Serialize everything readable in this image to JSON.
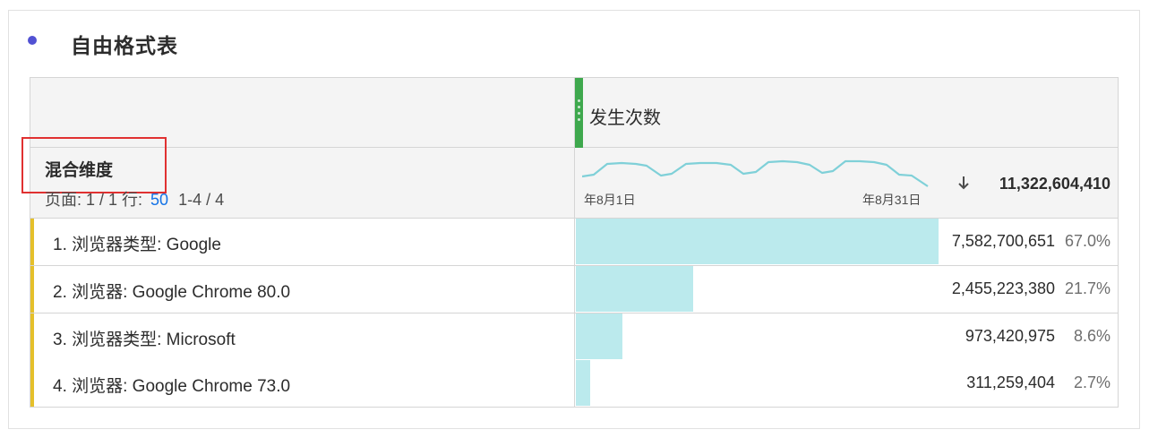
{
  "panel": {
    "title": "自由格式表",
    "dot_color": "#5151d3",
    "dot_icon": "panel-status-dot"
  },
  "table": {
    "metric": {
      "title": "发生次数",
      "handle_color": "#3ea84d",
      "handle_icon": "drag-grip-icon"
    },
    "dimension": {
      "title": "混合维度",
      "highlight_color": "#e03131"
    },
    "pager": {
      "page_label": "页面: 1 / 1 行:",
      "rows_per_page": "50",
      "range": "1-4 / 4"
    },
    "sparkline": {
      "start_label": "年8月1日",
      "end_label": "年8月31日",
      "color": "#7fd0d8"
    },
    "sort_icon": "arrow-down-icon",
    "total": "11,322,604,410",
    "bar_color": "#bbeaed",
    "accent_color": "#e5c02b",
    "rows": [
      {
        "label": "1. 浏览器类型: Google",
        "value": "7,582,700,651",
        "percent": "67.0%",
        "share": 0.67
      },
      {
        "label": "2. 浏览器: Google Chrome 80.0",
        "value": "2,455,223,380",
        "percent": "21.7%",
        "share": 0.217
      },
      {
        "label": "3. 浏览器类型: Microsoft",
        "value": "973,420,975",
        "percent": "8.6%",
        "share": 0.086
      },
      {
        "label": "4. 浏览器: Google Chrome 73.0",
        "value": "311,259,404",
        "percent": "2.7%",
        "share": 0.027
      }
    ]
  }
}
